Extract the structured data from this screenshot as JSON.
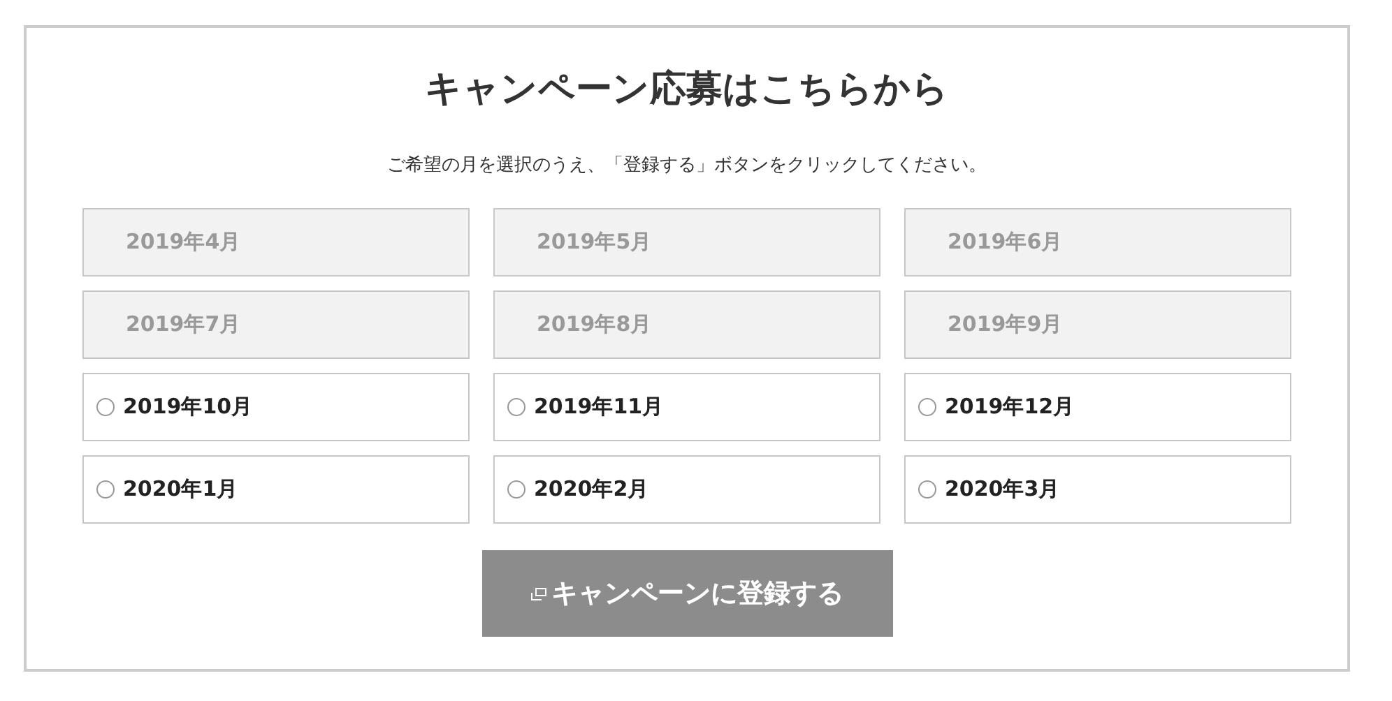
{
  "title": "キャンペーン応募はこちらから",
  "instruction": "ご希望の月を選択のうえ、「登録する」ボタンをクリックしてください。",
  "months": [
    {
      "label": "2019年4月",
      "disabled": true
    },
    {
      "label": "2019年5月",
      "disabled": true
    },
    {
      "label": "2019年6月",
      "disabled": true
    },
    {
      "label": "2019年7月",
      "disabled": true
    },
    {
      "label": "2019年8月",
      "disabled": true
    },
    {
      "label": "2019年9月",
      "disabled": true
    },
    {
      "label": "2019年10月",
      "disabled": false,
      "checked": false
    },
    {
      "label": "2019年11月",
      "disabled": false,
      "checked": false
    },
    {
      "label": "2019年12月",
      "disabled": false,
      "checked": false
    },
    {
      "label": "2020年1月",
      "disabled": false,
      "checked": false
    },
    {
      "label": "2020年2月",
      "disabled": false,
      "checked": false
    },
    {
      "label": "2020年3月",
      "disabled": false,
      "checked": false
    }
  ],
  "submit_button": "キャンペーンに登録する"
}
